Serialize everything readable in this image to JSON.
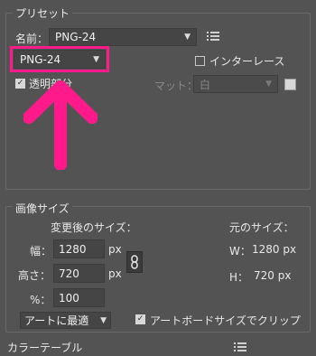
{
  "preset": {
    "title": "プリセット",
    "name_label": "名前：",
    "name_value": "PNG-24",
    "format_value": "PNG-24",
    "interlace_label": "インターレース",
    "transparency_label": "透明部分",
    "matte_label": "マット：",
    "matte_value": "白"
  },
  "image_size": {
    "title": "画像サイズ",
    "new_size_title": "変更後のサイズ：",
    "original_size_title": "元のサイズ：",
    "width_label": "幅：",
    "width_value": "1280",
    "height_label": "高さ：",
    "height_value": "720",
    "percent_label": "%：",
    "percent_value": "100",
    "unit": "px",
    "orig_width_label": "W：",
    "orig_width_value": "1280 px",
    "orig_height_label": "H：",
    "orig_height_value": "720 px",
    "resample_value": "アートに最適",
    "clip_label": "アートボードサイズでクリップ"
  },
  "color_table": {
    "title": "カラーテーブル"
  },
  "annotation": {
    "highlight_color": "#ff1a8c"
  },
  "icons": {
    "menu": "list-menu-icon",
    "link": "chain-link-icon",
    "arrow": "up-arrow-icon"
  }
}
